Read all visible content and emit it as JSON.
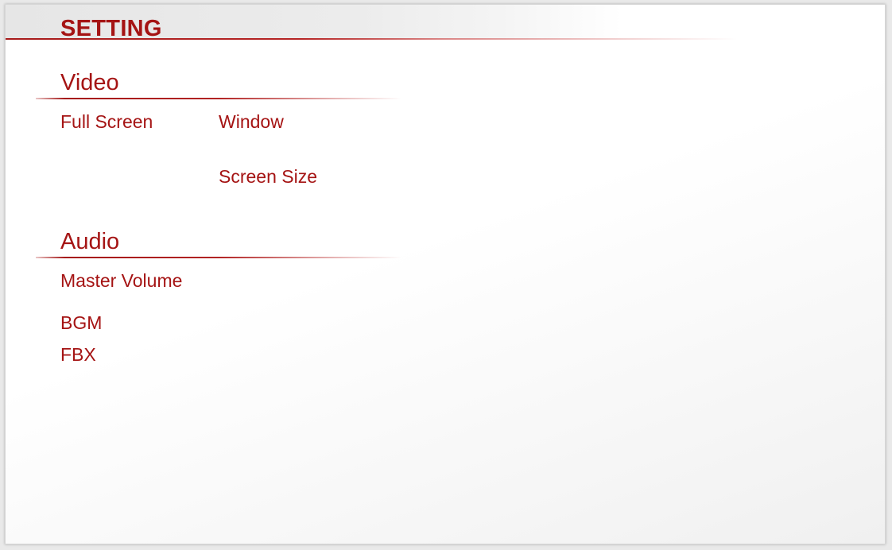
{
  "header": {
    "title": "SETTING"
  },
  "video": {
    "heading": "Video",
    "full_screen_label": "Full Screen",
    "window_label": "Window",
    "screen_size_label": "Screen Size"
  },
  "audio": {
    "heading": "Audio",
    "master_volume_label": "Master Volume",
    "bgm_label": "BGM",
    "fbx_label": "FBX"
  },
  "colors": {
    "accent": "#a51414",
    "titlebar_bg": "#e6e6e6",
    "panel_bg": "#ffffff"
  }
}
